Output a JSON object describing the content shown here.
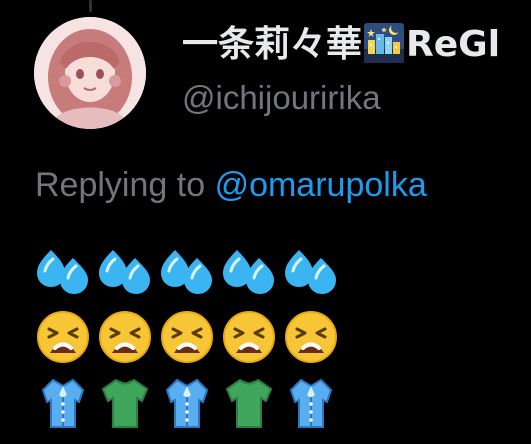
{
  "tweet": {
    "author": {
      "name_text": "一条莉々華",
      "name_emoji": "night-city-emoji",
      "name_suffix": "ReGl",
      "handle": "@ichijouririka",
      "avatar": "avatar-image"
    },
    "reply": {
      "prefix": "Replying to",
      "mention": "@omarupolka"
    },
    "body_rows": [
      [
        "sweat-droplets-emoji",
        "sweat-droplets-emoji",
        "sweat-droplets-emoji",
        "sweat-droplets-emoji",
        "sweat-droplets-emoji"
      ],
      [
        "tired-face-emoji",
        "tired-face-emoji",
        "tired-face-emoji",
        "tired-face-emoji",
        "tired-face-emoji"
      ],
      [
        "blouse-emoji",
        "t-shirt-emoji",
        "blouse-emoji",
        "t-shirt-emoji",
        "blouse-emoji"
      ]
    ]
  },
  "colors": {
    "background": "#000000",
    "primary_text": "#e7e9ea",
    "secondary_text": "#71767b",
    "link": "#1d9bf0"
  }
}
